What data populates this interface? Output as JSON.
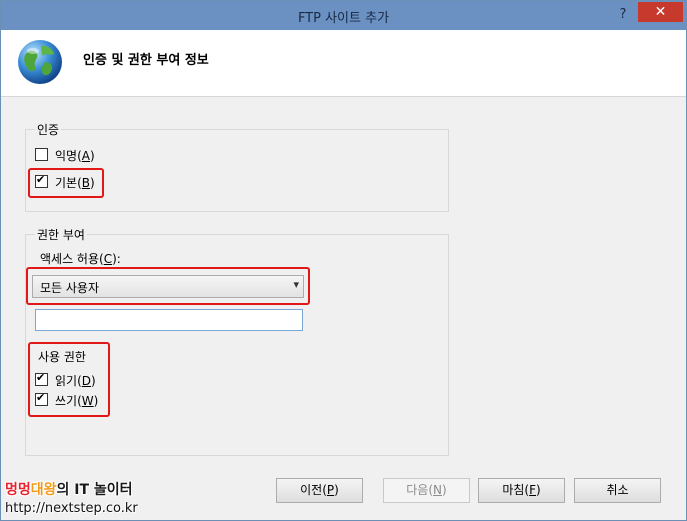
{
  "window": {
    "title": "FTP 사이트 추가",
    "help": "?",
    "close": "✕"
  },
  "header": {
    "title": "인증 및 권한 부여 정보"
  },
  "auth": {
    "label": "인증",
    "anonymous": {
      "text": "익명",
      "key": "A",
      "checked": false
    },
    "basic": {
      "text": "기본",
      "key": "B",
      "checked": true
    }
  },
  "authorization": {
    "label": "권한 부여",
    "access_label": "액세스 허용",
    "access_key": "C",
    "access_suffix": ":",
    "access_value": "모든 사용자",
    "access_input_value": "",
    "permissions_label": "사용 권한",
    "read": {
      "text": "읽기",
      "key": "D",
      "checked": true
    },
    "write": {
      "text": "쓰기",
      "key": "W",
      "checked": true
    }
  },
  "buttons": {
    "prev": {
      "text": "이전",
      "key": "P"
    },
    "next": {
      "text": "다음",
      "key": "N"
    },
    "finish": {
      "text": "마침",
      "key": "F"
    },
    "cancel": {
      "text": "취소"
    }
  },
  "watermark": {
    "part1": "멍멍",
    "part2": "대왕",
    "part3": "의 IT 놀이터",
    "url": "http://nextstep.co.kr"
  },
  "icons": {
    "globe": "globe-icon",
    "checkmark": "checkmark-icon",
    "dropdown": "chevron-down-icon"
  },
  "colors": {
    "titlebar": "#6b91c3",
    "close": "#c7392c",
    "highlight": "#e01818"
  }
}
